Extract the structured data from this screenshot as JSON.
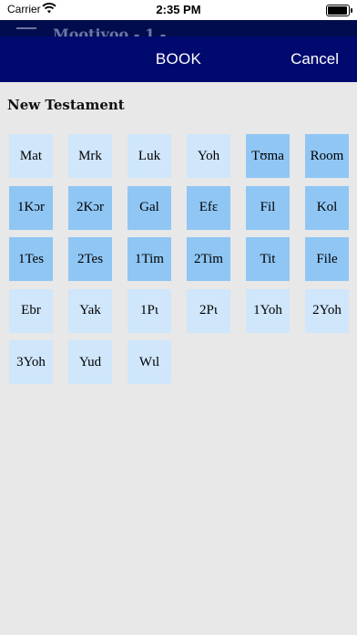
{
  "status_bar": {
    "carrier": "Carrier",
    "time": "2:35 PM",
    "wifi_icon": "wifi-icon",
    "battery_icon": "battery-icon"
  },
  "background_header": {
    "title": "Mootiyoo - 1 -",
    "menu_icon": "hamburger-menu-icon"
  },
  "navbar": {
    "title": "BOOK",
    "cancel_label": "Cancel",
    "background_color": "#000a6e"
  },
  "section": {
    "title": "New Testament"
  },
  "colors": {
    "tile_light": "#cfe6fb",
    "tile_dark": "#8fc6f4",
    "page_background": "#e8e8e8"
  },
  "books": [
    {
      "label": "Mat",
      "shade": "light"
    },
    {
      "label": "Mrk",
      "shade": "light"
    },
    {
      "label": "Luk",
      "shade": "light"
    },
    {
      "label": "Yoh",
      "shade": "light"
    },
    {
      "label": "Tʊma",
      "shade": "dark"
    },
    {
      "label": "Room",
      "shade": "dark"
    },
    {
      "label": "1Kɔr",
      "shade": "dark"
    },
    {
      "label": "2Kɔr",
      "shade": "dark"
    },
    {
      "label": "Gal",
      "shade": "dark"
    },
    {
      "label": "Efɛ",
      "shade": "dark"
    },
    {
      "label": "Fil",
      "shade": "dark"
    },
    {
      "label": "Kol",
      "shade": "dark"
    },
    {
      "label": "1Tes",
      "shade": "dark"
    },
    {
      "label": "2Tes",
      "shade": "dark"
    },
    {
      "label": "1Tim",
      "shade": "dark"
    },
    {
      "label": "2Tim",
      "shade": "dark"
    },
    {
      "label": "Tit",
      "shade": "dark"
    },
    {
      "label": "File",
      "shade": "dark"
    },
    {
      "label": "Ebr",
      "shade": "light"
    },
    {
      "label": "Yak",
      "shade": "light"
    },
    {
      "label": "1Pɩ",
      "shade": "light"
    },
    {
      "label": "2Pɩ",
      "shade": "light"
    },
    {
      "label": "1Yoh",
      "shade": "light"
    },
    {
      "label": "2Yoh",
      "shade": "light"
    },
    {
      "label": "3Yoh",
      "shade": "light"
    },
    {
      "label": "Yud",
      "shade": "light"
    },
    {
      "label": "Wɩl",
      "shade": "light"
    }
  ]
}
